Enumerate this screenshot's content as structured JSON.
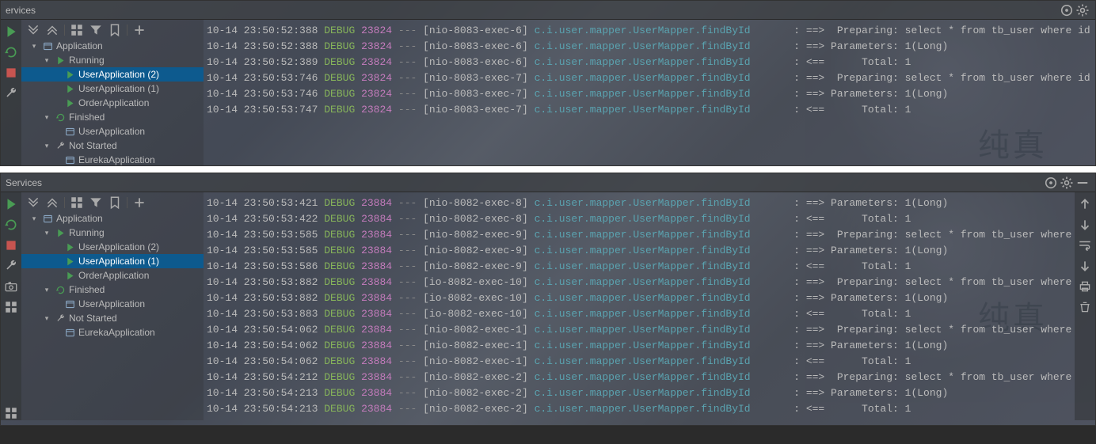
{
  "panels": [
    {
      "title": "ervices",
      "showMinimize": false,
      "tree": {
        "root": "Application",
        "running": "Running",
        "apps": [
          {
            "name": "UserApplication (2)",
            "sel": true
          },
          {
            "name": "UserApplication (1)",
            "sel": false
          },
          {
            "name": "OrderApplication",
            "sel": false
          }
        ],
        "finished": "Finished",
        "finishedApp": "UserApplication",
        "notStarted": "Not Started",
        "notStartedApp": "EurekaApplication"
      },
      "logs": [
        {
          "ts": "10-14 23:50:52:388",
          "lvl": "DEBUG",
          "pid": "23824",
          "thr": "[nio-8083-exec-6]",
          "logger": "c.i.user.mapper.UserMapper.findById",
          "msg": ": ==>  Preparing: select * from tb_user where id = ?"
        },
        {
          "ts": "10-14 23:50:52:388",
          "lvl": "DEBUG",
          "pid": "23824",
          "thr": "[nio-8083-exec-6]",
          "logger": "c.i.user.mapper.UserMapper.findById",
          "msg": ": ==> Parameters: 1(Long)"
        },
        {
          "ts": "10-14 23:50:52:389",
          "lvl": "DEBUG",
          "pid": "23824",
          "thr": "[nio-8083-exec-6]",
          "logger": "c.i.user.mapper.UserMapper.findById",
          "msg": ": <==      Total: 1"
        },
        {
          "ts": "10-14 23:50:53:746",
          "lvl": "DEBUG",
          "pid": "23824",
          "thr": "[nio-8083-exec-7]",
          "logger": "c.i.user.mapper.UserMapper.findById",
          "msg": ": ==>  Preparing: select * from tb_user where id = ?"
        },
        {
          "ts": "10-14 23:50:53:746",
          "lvl": "DEBUG",
          "pid": "23824",
          "thr": "[nio-8083-exec-7]",
          "logger": "c.i.user.mapper.UserMapper.findById",
          "msg": ": ==> Parameters: 1(Long)"
        },
        {
          "ts": "10-14 23:50:53:747",
          "lvl": "DEBUG",
          "pid": "23824",
          "thr": "[nio-8083-exec-7]",
          "logger": "c.i.user.mapper.UserMapper.findById",
          "msg": ": <==      Total: 1"
        }
      ]
    },
    {
      "title": "Services",
      "showMinimize": true,
      "tree": {
        "root": "Application",
        "running": "Running",
        "apps": [
          {
            "name": "UserApplication (2)",
            "sel": false
          },
          {
            "name": "UserApplication (1)",
            "sel": true
          },
          {
            "name": "OrderApplication",
            "sel": false
          }
        ],
        "finished": "Finished",
        "finishedApp": "UserApplication",
        "notStarted": "Not Started",
        "notStartedApp": "EurekaApplication"
      },
      "logs": [
        {
          "ts": "10-14 23:50:53:421",
          "lvl": "DEBUG",
          "pid": "23884",
          "thr": "[nio-8082-exec-8]",
          "logger": "c.i.user.mapper.UserMapper.findById",
          "msg": ": ==> Parameters: 1(Long)"
        },
        {
          "ts": "10-14 23:50:53:422",
          "lvl": "DEBUG",
          "pid": "23884",
          "thr": "[nio-8082-exec-8]",
          "logger": "c.i.user.mapper.UserMapper.findById",
          "msg": ": <==      Total: 1"
        },
        {
          "ts": "10-14 23:50:53:585",
          "lvl": "DEBUG",
          "pid": "23884",
          "thr": "[nio-8082-exec-9]",
          "logger": "c.i.user.mapper.UserMapper.findById",
          "msg": ": ==>  Preparing: select * from tb_user where id = ?"
        },
        {
          "ts": "10-14 23:50:53:585",
          "lvl": "DEBUG",
          "pid": "23884",
          "thr": "[nio-8082-exec-9]",
          "logger": "c.i.user.mapper.UserMapper.findById",
          "msg": ": ==> Parameters: 1(Long)"
        },
        {
          "ts": "10-14 23:50:53:586",
          "lvl": "DEBUG",
          "pid": "23884",
          "thr": "[nio-8082-exec-9]",
          "logger": "c.i.user.mapper.UserMapper.findById",
          "msg": ": <==      Total: 1"
        },
        {
          "ts": "10-14 23:50:53:882",
          "lvl": "DEBUG",
          "pid": "23884",
          "thr": "[io-8082-exec-10]",
          "logger": "c.i.user.mapper.UserMapper.findById",
          "msg": ": ==>  Preparing: select * from tb_user where id = ?"
        },
        {
          "ts": "10-14 23:50:53:882",
          "lvl": "DEBUG",
          "pid": "23884",
          "thr": "[io-8082-exec-10]",
          "logger": "c.i.user.mapper.UserMapper.findById",
          "msg": ": ==> Parameters: 1(Long)"
        },
        {
          "ts": "10-14 23:50:53:883",
          "lvl": "DEBUG",
          "pid": "23884",
          "thr": "[io-8082-exec-10]",
          "logger": "c.i.user.mapper.UserMapper.findById",
          "msg": ": <==      Total: 1"
        },
        {
          "ts": "10-14 23:50:54:062",
          "lvl": "DEBUG",
          "pid": "23884",
          "thr": "[nio-8082-exec-1]",
          "logger": "c.i.user.mapper.UserMapper.findById",
          "msg": ": ==>  Preparing: select * from tb_user where id = ?"
        },
        {
          "ts": "10-14 23:50:54:062",
          "lvl": "DEBUG",
          "pid": "23884",
          "thr": "[nio-8082-exec-1]",
          "logger": "c.i.user.mapper.UserMapper.findById",
          "msg": ": ==> Parameters: 1(Long)"
        },
        {
          "ts": "10-14 23:50:54:062",
          "lvl": "DEBUG",
          "pid": "23884",
          "thr": "[nio-8082-exec-1]",
          "logger": "c.i.user.mapper.UserMapper.findById",
          "msg": ": <==      Total: 1"
        },
        {
          "ts": "10-14 23:50:54:212",
          "lvl": "DEBUG",
          "pid": "23884",
          "thr": "[nio-8082-exec-2]",
          "logger": "c.i.user.mapper.UserMapper.findById",
          "msg": ": ==>  Preparing: select * from tb_user where id = ?"
        },
        {
          "ts": "10-14 23:50:54:213",
          "lvl": "DEBUG",
          "pid": "23884",
          "thr": "[nio-8082-exec-2]",
          "logger": "c.i.user.mapper.UserMapper.findById",
          "msg": ": ==> Parameters: 1(Long)"
        },
        {
          "ts": "10-14 23:50:54:213",
          "lvl": "DEBUG",
          "pid": "23884",
          "thr": "[nio-8082-exec-2]",
          "logger": "c.i.user.mapper.UserMapper.findById",
          "msg": ": <==      Total: 1"
        }
      ]
    }
  ]
}
